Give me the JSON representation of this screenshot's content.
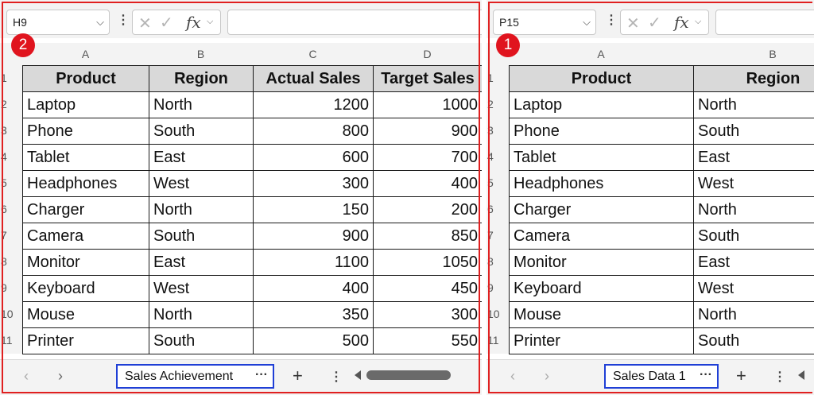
{
  "left_pane": {
    "badge": "2",
    "name_box": "H9",
    "columns": [
      "A",
      "B",
      "C",
      "D"
    ],
    "rows": [
      "1",
      "2",
      "3",
      "4",
      "5",
      "6",
      "7",
      "8",
      "9",
      "10",
      "11"
    ],
    "table": {
      "headers": [
        "Product",
        "Region",
        "Actual Sales",
        "Target Sales"
      ],
      "data": [
        [
          "Laptop",
          "North",
          "1200",
          "1000"
        ],
        [
          "Phone",
          "South",
          "800",
          "900"
        ],
        [
          "Tablet",
          "East",
          "600",
          "700"
        ],
        [
          "Headphones",
          "West",
          "300",
          "400"
        ],
        [
          "Charger",
          "North",
          "150",
          "200"
        ],
        [
          "Camera",
          "South",
          "900",
          "850"
        ],
        [
          "Monitor",
          "East",
          "1100",
          "1050"
        ],
        [
          "Keyboard",
          "West",
          "400",
          "450"
        ],
        [
          "Mouse",
          "North",
          "350",
          "300"
        ],
        [
          "Printer",
          "South",
          "500",
          "550"
        ]
      ]
    },
    "sheet_tab": "Sales Achievement"
  },
  "right_pane": {
    "badge": "1",
    "name_box": "P15",
    "columns": [
      "A",
      "B"
    ],
    "rows": [
      "1",
      "2",
      "3",
      "4",
      "5",
      "6",
      "7",
      "8",
      "9",
      "10",
      "11"
    ],
    "table": {
      "headers": [
        "Product",
        "Region"
      ],
      "data": [
        [
          "Laptop",
          "North"
        ],
        [
          "Phone",
          "South"
        ],
        [
          "Tablet",
          "East"
        ],
        [
          "Headphones",
          "West"
        ],
        [
          "Charger",
          "North"
        ],
        [
          "Camera",
          "South"
        ],
        [
          "Monitor",
          "East"
        ],
        [
          "Keyboard",
          "West"
        ],
        [
          "Mouse",
          "North"
        ],
        [
          "Printer",
          "South"
        ]
      ]
    },
    "sheet_tab": "Sales Data 1"
  },
  "icons": {
    "more_vertical": "⋮",
    "cancel": "✕",
    "confirm": "✓",
    "function": "fx",
    "dropdown": "⌵",
    "prev_sheet": "‹",
    "next_sheet": "›",
    "more_horizontal": "···",
    "add_sheet": "+"
  },
  "colors": {
    "highlight_frame": "#e02020",
    "badge": "#e0141e",
    "tab_highlight": "#1f3fd6",
    "header_fill": "#d9d9d9"
  }
}
